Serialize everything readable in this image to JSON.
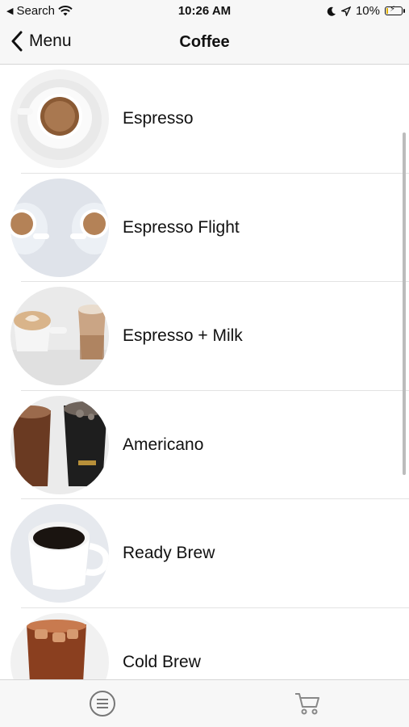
{
  "status_bar": {
    "back_app": "Search",
    "time": "10:26 AM",
    "battery": "10%"
  },
  "nav": {
    "back_label": "Menu",
    "title": "Coffee"
  },
  "items": [
    {
      "label": "Espresso",
      "icon": "espresso-cup-image"
    },
    {
      "label": "Espresso Flight",
      "icon": "espresso-flight-image"
    },
    {
      "label": "Espresso + Milk",
      "icon": "latte-image"
    },
    {
      "label": "Americano",
      "icon": "americano-image"
    },
    {
      "label": "Ready Brew",
      "icon": "ready-brew-image"
    },
    {
      "label": "Cold Brew",
      "icon": "cold-brew-image"
    }
  ],
  "tab_bar": {
    "tabs": [
      {
        "name": "menu",
        "icon": "list-icon"
      },
      {
        "name": "cart",
        "icon": "cart-icon"
      }
    ]
  }
}
